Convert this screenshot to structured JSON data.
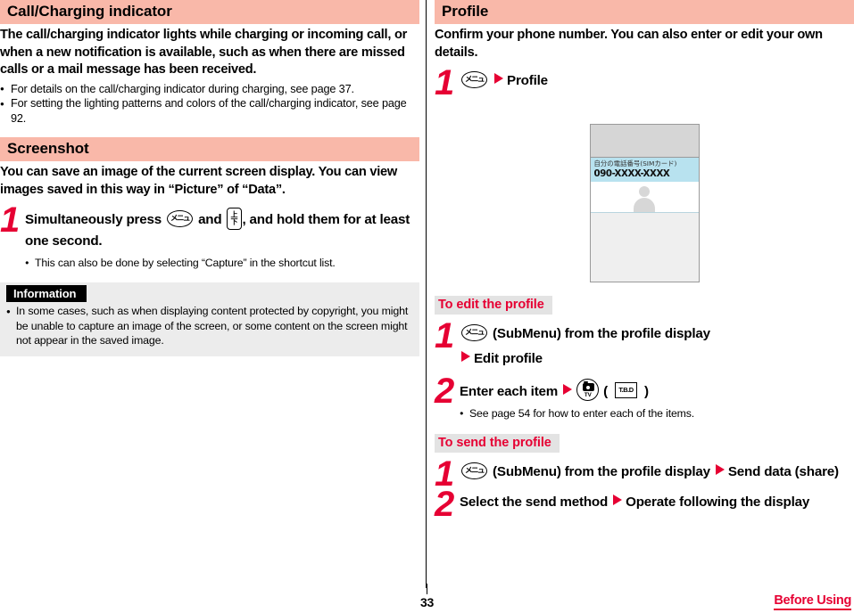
{
  "left_column": {
    "section1": {
      "heading": "Call/Charging indicator",
      "intro": "The call/charging indicator lights while charging or incoming call, or when a new notification is available, such as when there are missed calls or a mail message has been received.",
      "bullets": [
        "For details on the call/charging indicator during charging, see page 37.",
        "For setting the lighting patterns and colors of the call/charging indicator, see page 92."
      ]
    },
    "section2": {
      "heading": "Screenshot",
      "intro": "You can save an image of the current screen display. You can view images saved in this way in “Picture” of “Data”.",
      "step1": {
        "number": "1",
        "text_before_key1": "Simultaneously press",
        "key1": "menu-key",
        "key1_glyph": "メニュ",
        "text_between": "and",
        "key2": "clear-key",
        "key2_glyph_top": "上",
        "key2_glyph_bottom": "下",
        "text_after": ", and hold them for at least one second.",
        "notes": [
          "This can also be done by selecting “Capture” in the shortcut list."
        ]
      },
      "information": {
        "label": "Information",
        "bullets": [
          "In some cases, such as when displaying content protected by copyright, you might be unable to capture an image of the screen, or some content on the screen might not appear in the saved image."
        ]
      }
    }
  },
  "right_column": {
    "section1": {
      "heading": "Profile",
      "intro": "Confirm your phone number. You can also enter or edit your own details.",
      "step1": {
        "number": "1",
        "key_glyph": "メニュ",
        "label": "Profile"
      },
      "phone_mockup": {
        "field_label": "自分の電話番号(SIMカード)",
        "phone_number": "090-XXXX-XXXX"
      }
    },
    "subsection_edit": {
      "heading": "To edit the profile",
      "step1": {
        "number": "1",
        "key_glyph": "メニュ",
        "text_a": "(SubMenu) from the profile display",
        "text_b": "Edit profile"
      },
      "step2": {
        "number": "2",
        "text_a": "Enter each item",
        "camera_key_label": "TV",
        "paren_open": "(",
        "tbd_label": "T.B.D",
        "paren_close": ")",
        "notes": [
          "See page 54 for how to enter each of the items."
        ]
      }
    },
    "subsection_send": {
      "heading": "To send the profile",
      "step1": {
        "number": "1",
        "key_glyph": "メニュ",
        "text_a": "(SubMenu) from the profile display",
        "text_b": "Send data (share)"
      },
      "step2": {
        "number": "2",
        "text_a": "Select the send method",
        "text_b": "Operate following the display"
      }
    }
  },
  "footer": {
    "page_number": "33",
    "chapter": "Before Using"
  },
  "colors": {
    "section_bar_pink": "#f9b8a9",
    "accent_red": "#e60033",
    "subhead_gray": "#e3e3e3",
    "info_gray": "#ececec",
    "screen_highlight_blue": "#b8e2ef"
  }
}
